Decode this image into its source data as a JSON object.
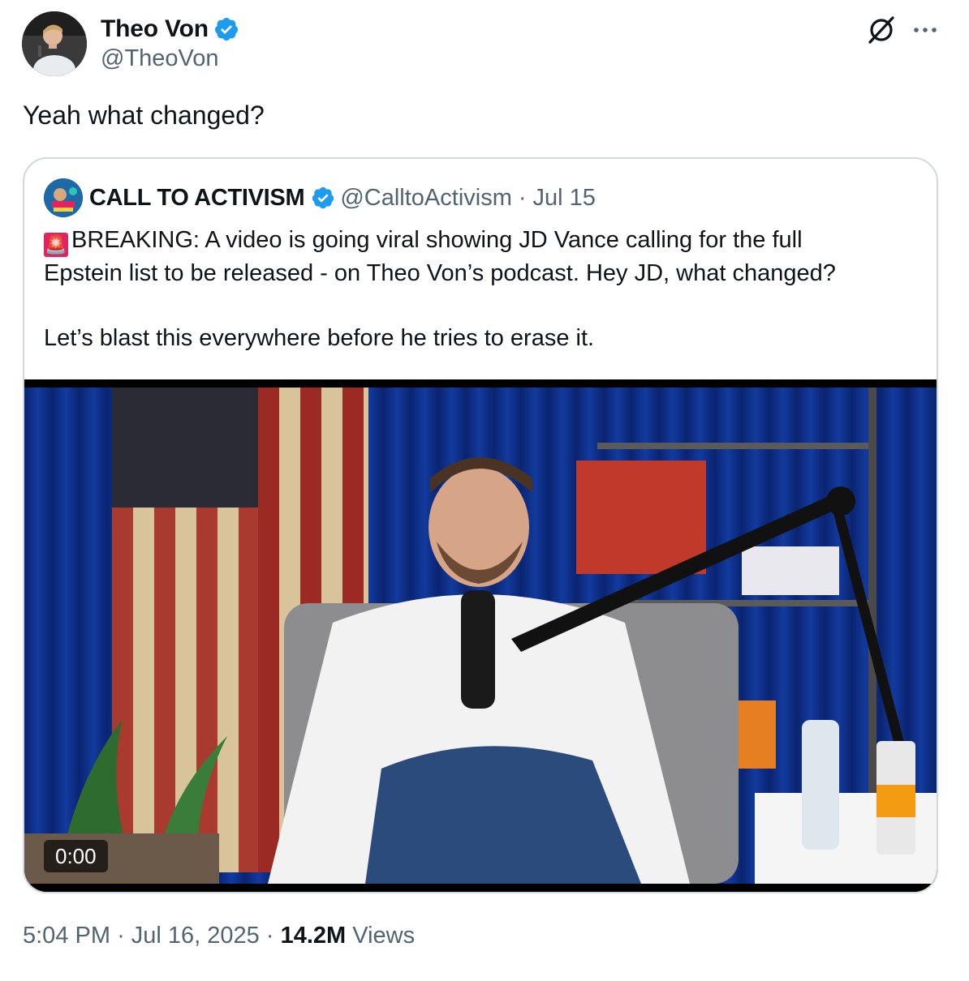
{
  "author": {
    "display_name": "Theo Von",
    "handle": "@TheoVon",
    "verified": true,
    "avatar_icon": "profile-photo"
  },
  "tweet": {
    "text": "Yeah what changed?"
  },
  "quoted": {
    "display_name": "CALL TO ACTIVISM",
    "handle": "@CalltoActivism",
    "separator": "·",
    "date": "Jul 15",
    "emoji": "🚨",
    "line1": "BREAKING: A video is going viral showing JD Vance calling for the full",
    "line2": "Epstein list to be released - on Theo Von’s podcast. Hey JD, what changed?",
    "line3": "Let’s blast this everywhere before he tries to erase it.",
    "video_time": "0:00"
  },
  "footer": {
    "time": "5:04 PM",
    "sep1": "·",
    "date": "Jul 16, 2025",
    "sep2": "·",
    "views_count": "14.2M",
    "views_label": "Views"
  },
  "colors": {
    "verified_blue": "#1d9bf0",
    "muted_text": "#536471",
    "border": "#cfd9de"
  },
  "icons": [
    "grok-icon",
    "more-icon",
    "verified-badge-icon",
    "siren-emoji"
  ]
}
